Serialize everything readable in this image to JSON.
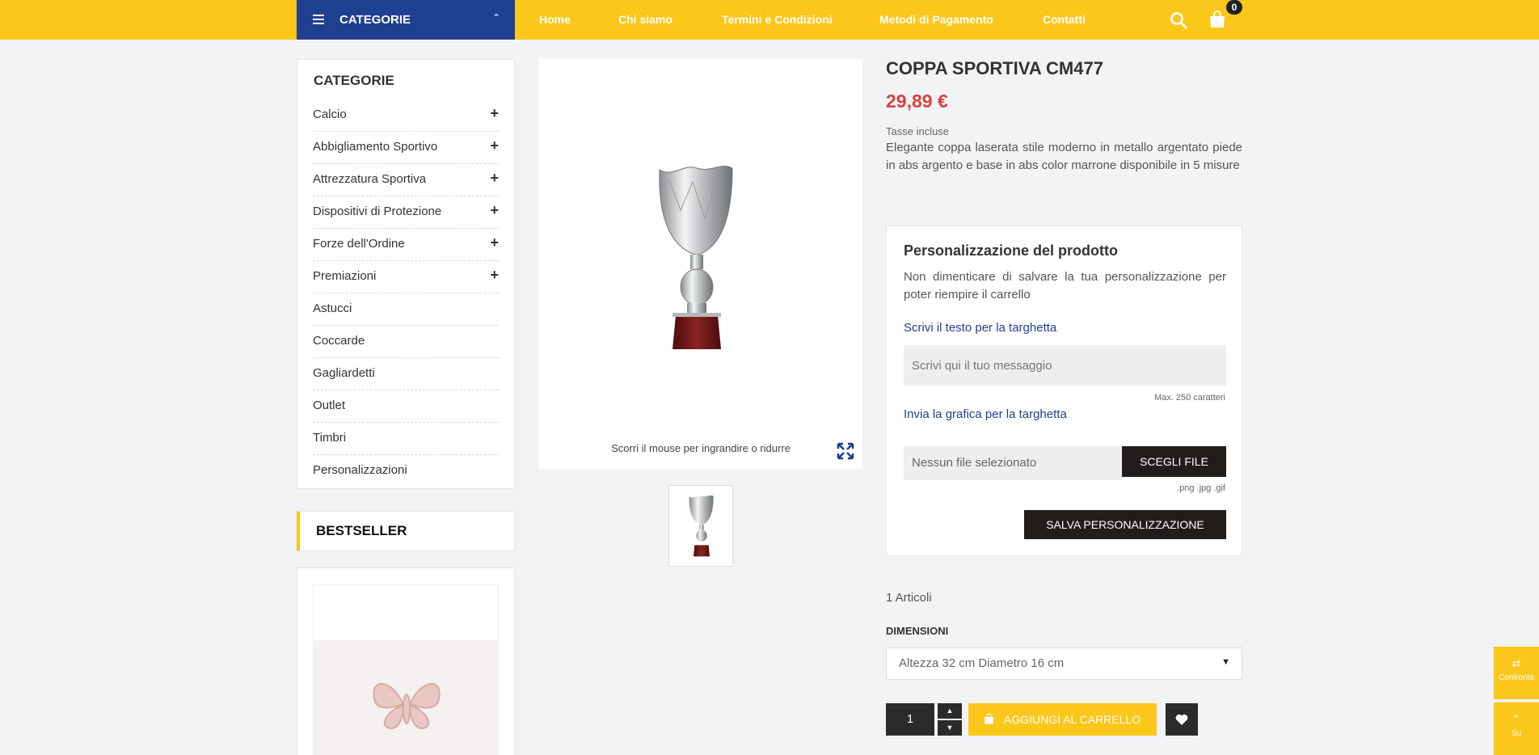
{
  "header": {
    "categories_label": "CATEGORIE",
    "nav": [
      "Home",
      "Chi siamo",
      "Termini e Condizioni",
      "Metodi di Pagamento",
      "Contatti"
    ],
    "cart_count": "0",
    "accent": "#fcc71b",
    "brand_blue": "#1f3f8f"
  },
  "sidebar": {
    "title": "CATEGORIE",
    "items": [
      {
        "label": "Calcio",
        "expandable": "+"
      },
      {
        "label": "Abbigliamento Sportivo",
        "expandable": "+"
      },
      {
        "label": "Attrezzatura Sportiva",
        "expandable": "+"
      },
      {
        "label": "Dispositivi di Protezione",
        "expandable": "+"
      },
      {
        "label": "Forze dell'Ordine",
        "expandable": "+"
      },
      {
        "label": "Premiazioni",
        "expandable": "+"
      },
      {
        "label": "Astucci",
        "expandable": ""
      },
      {
        "label": "Coccarde",
        "expandable": ""
      },
      {
        "label": "Gagliardetti",
        "expandable": ""
      },
      {
        "label": "Outlet",
        "expandable": ""
      },
      {
        "label": "Timbri",
        "expandable": ""
      },
      {
        "label": "Personalizzazioni",
        "expandable": ""
      }
    ],
    "bestseller_title": "BESTSELLER"
  },
  "gallery": {
    "hint": "Scorri il mouse per ingrandire o ridurre"
  },
  "product": {
    "title": "COPPA SPORTIVA CM477",
    "price": "29,89 €",
    "tax": "Tasse incluse",
    "description": "Elegante coppa laserata stile moderno in metallo argentato piede in abs argento e base in abs color marrone disponibile in 5 misure",
    "price_color": "#d9413d"
  },
  "customization": {
    "title": "Personalizzazione del prodotto",
    "note": "Non dimenticare di salvare la tua personalizzazione per poter riempire il carrello",
    "text_label": "Scrivi il testo per la targhetta",
    "text_placeholder": "Scrivi qui il tuo messaggio",
    "max_chars": "Max. 250 caratteri",
    "file_label": "Invia la grafica per la targhetta",
    "file_value": "Nessun file selezionato",
    "choose_button": "SCEGLI FILE",
    "allowed_ext": ".png .jpg .gif",
    "save_button": "SALVA PERSONALIZZAZIONE"
  },
  "purchase": {
    "stock": "1 Articoli",
    "dimension_label": "DIMENSIONI",
    "dimension_value": "Altezza 32 cm Diametro 16 cm",
    "quantity": "1",
    "add_to_cart": "AGGIUNGI AL CARRELLO"
  },
  "floating": {
    "compare": "Confronta",
    "top": "Su"
  }
}
